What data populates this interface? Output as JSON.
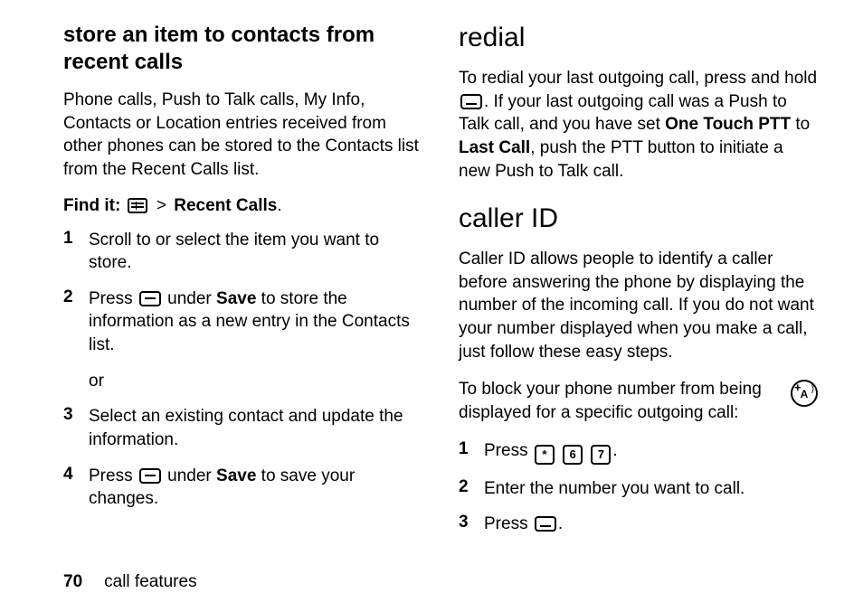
{
  "left": {
    "heading": "store an item to contacts from recent calls",
    "intro": "Phone calls, Push to Talk calls, My Info, Contacts or Location entries received from other phones can be stored to the Contacts list from the Recent Calls list.",
    "findit_label": "Find it:",
    "findit_gt": ">",
    "findit_target": "Recent Calls",
    "findit_period": ".",
    "steps": [
      {
        "n": "1",
        "text": "Scroll to or select the item you want to store."
      },
      {
        "n": "2",
        "pre": "Press ",
        "mid": " under ",
        "bold": "Save",
        "post": " to store the information as a new entry in the Contacts list.",
        "or": "or"
      },
      {
        "n": "3",
        "text": "Select an existing contact and update the information."
      },
      {
        "n": "4",
        "pre": "Press ",
        "mid": " under ",
        "bold": "Save",
        "post": " to save your changes."
      }
    ]
  },
  "right": {
    "redial_heading": "redial",
    "redial_pre": "To redial your last outgoing call, press and hold ",
    "redial_mid1": ". If your last outgoing call was a Push to Talk call, and you have set ",
    "redial_b1": "One Touch PTT",
    "redial_mid2": " to ",
    "redial_b2": "Last Call",
    "redial_post": ", push the PTT button to initiate a new Push to Talk call.",
    "caller_heading": "caller ID",
    "caller_intro": "Caller ID allows people to identify a caller before answering the phone by displaying the number of the incoming call. If you do not want your number displayed when you make a call, just follow these easy steps.",
    "caller_block": "To block your phone number from being displayed for a specific outgoing call:",
    "keys": {
      "star": "*",
      "six": "6",
      "seven": "7"
    },
    "steps": [
      {
        "n": "1",
        "pre": "Press ",
        "post": "."
      },
      {
        "n": "2",
        "text": "Enter the number you want to call."
      },
      {
        "n": "3",
        "pre": "Press ",
        "post": "."
      }
    ]
  },
  "footer": {
    "page": "70",
    "label": "call features"
  }
}
